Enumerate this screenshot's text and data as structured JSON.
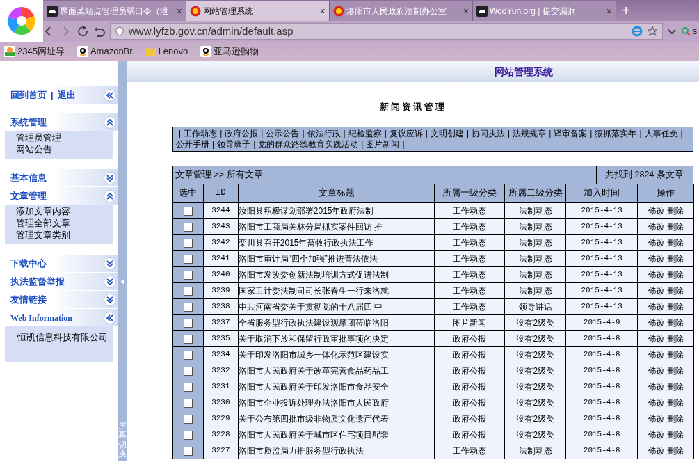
{
  "browser": {
    "tabs": [
      {
        "title": "界面某站点管理员弱口令（泄",
        "selected": false,
        "close": "×"
      },
      {
        "title": "网站管理系统",
        "selected": true,
        "close": "×"
      },
      {
        "title": "洛阳市人民政府法制办公室",
        "selected": false,
        "close": "×"
      },
      {
        "title": "WooYun.org | 提交漏洞",
        "selected": false,
        "close": "×"
      }
    ],
    "new_tab": "+",
    "address": "www.lyfzb.gov.cn/admin/default.asp",
    "search_text": "s",
    "bookmarks": [
      {
        "label": "2345网址导"
      },
      {
        "label": "AmazonBr"
      },
      {
        "label": "Lenovo"
      },
      {
        "label": "亚马逊购物"
      }
    ]
  },
  "header": {
    "title": "网站管理系统"
  },
  "sidebar": [
    {
      "kind": "nav",
      "links": [
        "回到首页",
        "退出"
      ],
      "separator": "|"
    },
    {
      "kind": "group",
      "title": "系统管理",
      "expanded": true,
      "items": [
        "管理员管理",
        "网站公告"
      ]
    },
    {
      "kind": "group",
      "title": "基本信息",
      "expanded": false
    },
    {
      "kind": "group",
      "title": "文章管理",
      "expanded": true,
      "items": [
        "添加文章内容",
        "管理全部文章",
        "管理文章类别"
      ]
    },
    {
      "kind": "group",
      "title": "下载中心",
      "expanded": false
    },
    {
      "kind": "group",
      "title": "执法监督举报",
      "expanded": false
    },
    {
      "kind": "group",
      "title": "友情链接",
      "expanded": false
    },
    {
      "kind": "info",
      "title": "Web Information",
      "text": "恒凯信息科技有限公司"
    }
  ],
  "splitter": {
    "label": "屏幕切换"
  },
  "page_title": "新闻资讯管理",
  "categories": {
    "separator": "|",
    "items": [
      "工作动态",
      "政府公报",
      "公示公告",
      "依法行政",
      "纪检监察",
      "复议应诉",
      "文明创建",
      "协同执法",
      "法规规章",
      "译审备案",
      "狠抓落实年",
      "人事任免",
      "公开手册",
      "领导班子",
      "党的群众路线教育实践活动",
      "图片新闻"
    ]
  },
  "table": {
    "breadcrumb": "文章管理 >> 所有文章",
    "count": "共找到 2824 条文章",
    "columns": [
      "选中",
      "ID",
      "文章标题",
      "所属一级分类",
      "所属二级分类",
      "加入时间",
      "操作"
    ],
    "rows": [
      {
        "checked": false,
        "id": "3244",
        "title": "汝阳县积极谋划部署2015年政府法制",
        "cat1": "工作动态",
        "cat2": "法制动态",
        "date": "2015-4-13",
        "actions": [
          "修改",
          "删除"
        ]
      },
      {
        "checked": false,
        "id": "3243",
        "title": "洛阳市工商局关林分局抓实案件回访 推",
        "cat1": "工作动态",
        "cat2": "法制动态",
        "date": "2015-4-13",
        "actions": [
          "修改",
          "删除"
        ]
      },
      {
        "checked": false,
        "id": "3242",
        "title": "栾川县召开2015年畜牧行政执法工作",
        "cat1": "工作动态",
        "cat2": "法制动态",
        "date": "2015-4-13",
        "actions": [
          "修改",
          "删除"
        ]
      },
      {
        "checked": false,
        "id": "3241",
        "title": "洛阳市审计局“四个加强”推进普法依法",
        "cat1": "工作动态",
        "cat2": "法制动态",
        "date": "2015-4-13",
        "actions": [
          "修改",
          "删除"
        ]
      },
      {
        "checked": false,
        "id": "3240",
        "title": "洛阳市发改委创新法制培训方式促进法制",
        "cat1": "工作动态",
        "cat2": "法制动态",
        "date": "2015-4-13",
        "actions": [
          "修改",
          "删除"
        ]
      },
      {
        "checked": false,
        "id": "3239",
        "title": "国家卫计委法制司司长张春生一行来洛就",
        "cat1": "工作动态",
        "cat2": "法制动态",
        "date": "2015-4-13",
        "actions": [
          "修改",
          "删除"
        ]
      },
      {
        "checked": false,
        "id": "3238",
        "title": "中共河南省委关于贯彻党的十八届四 中",
        "cat1": "工作动态",
        "cat2": "领导讲话",
        "date": "2015-4-13",
        "actions": [
          "修改",
          "删除"
        ]
      },
      {
        "checked": false,
        "id": "3237",
        "title": "全省服务型行政执法建设观摩团莅临洛阳",
        "cat1": "图片新闻",
        "cat2": "没有2级类",
        "date": "2015-4-9",
        "actions": [
          "修改",
          "删除"
        ]
      },
      {
        "checked": false,
        "id": "3235",
        "title": "关于取消下放和保留行政审批事项的决定",
        "cat1": "政府公报",
        "cat2": "没有2级类",
        "date": "2015-4-8",
        "actions": [
          "修改",
          "删除"
        ]
      },
      {
        "checked": false,
        "id": "3234",
        "title": "关于印发洛阳市城乡一体化示范区建设实",
        "cat1": "政府公报",
        "cat2": "没有2级类",
        "date": "2015-4-8",
        "actions": [
          "修改",
          "删除"
        ]
      },
      {
        "checked": false,
        "id": "3232",
        "title": "洛阳市人民政府关于改革完善食品药品工",
        "cat1": "政府公报",
        "cat2": "没有2级类",
        "date": "2015-4-8",
        "actions": [
          "修改",
          "删除"
        ]
      },
      {
        "checked": false,
        "id": "3231",
        "title": "洛阳市人民政府关于印发洛阳市食品安全",
        "cat1": "政府公报",
        "cat2": "没有2级类",
        "date": "2015-4-8",
        "actions": [
          "修改",
          "删除"
        ]
      },
      {
        "checked": false,
        "id": "3230",
        "title": "洛阳市企业投诉处理办法洛阳市人民政府",
        "cat1": "政府公报",
        "cat2": "没有2级类",
        "date": "2015-4-8",
        "actions": [
          "修改",
          "删除"
        ]
      },
      {
        "checked": false,
        "id": "3229",
        "title": "关于公布第四批市级非物质文化遗产代表",
        "cat1": "政府公报",
        "cat2": "没有2级类",
        "date": "2015-4-8",
        "actions": [
          "修改",
          "删除"
        ]
      },
      {
        "checked": false,
        "id": "3228",
        "title": "洛阳市人民政府关于城市区住宅项目配套",
        "cat1": "政府公报",
        "cat2": "没有2级类",
        "date": "2015-4-8",
        "actions": [
          "修改",
          "删除"
        ]
      },
      {
        "checked": false,
        "id": "3227",
        "title": "洛阳市质监局力推服务型行政执法",
        "cat1": "工作动态",
        "cat2": "法制动态",
        "date": "2015-4-8",
        "actions": [
          "修改",
          "删除"
        ]
      }
    ]
  }
}
